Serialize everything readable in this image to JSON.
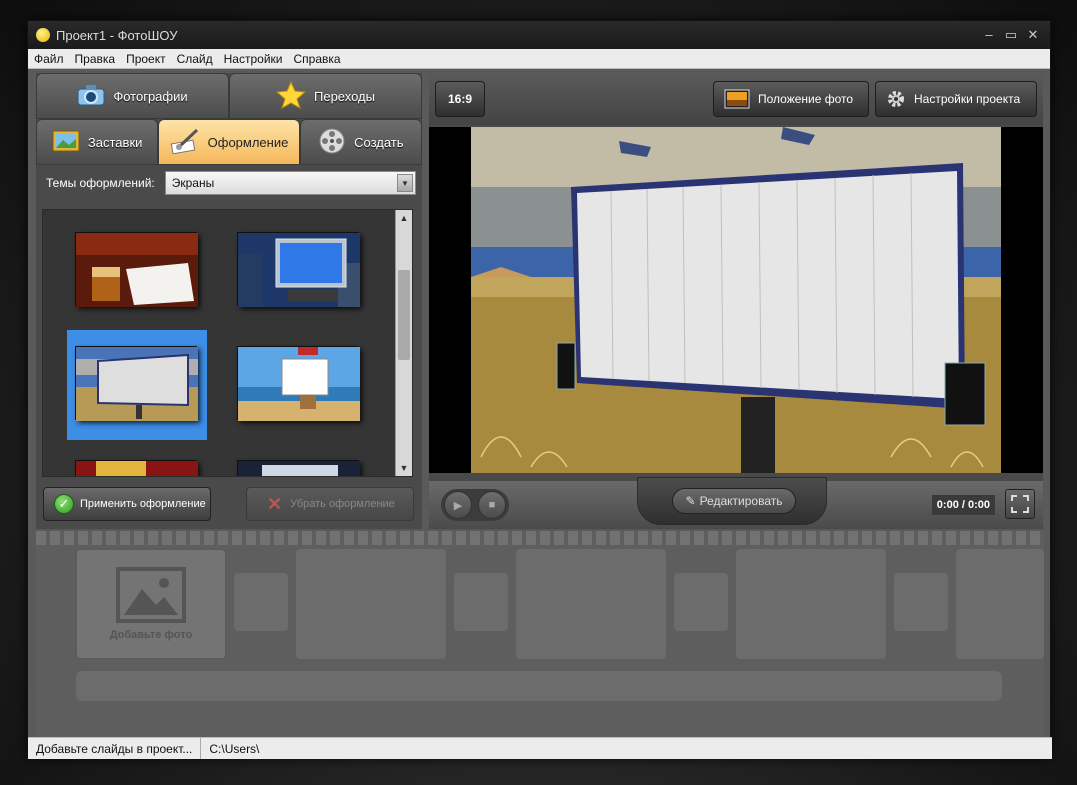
{
  "window": {
    "title": "Проект1 - ФотоШОУ",
    "controls": [
      "–",
      "▭",
      "✕"
    ]
  },
  "menu": [
    "Файл",
    "Правка",
    "Проект",
    "Слайд",
    "Настройки",
    "Справка"
  ],
  "tabs": {
    "row1": [
      {
        "label": "Фотографии",
        "icon": "camera-icon"
      },
      {
        "label": "Переходы",
        "icon": "star-icon"
      }
    ],
    "row2": [
      {
        "label": "Заставки",
        "icon": "picture-frame-icon"
      },
      {
        "label": "Оформление",
        "icon": "brush-icon",
        "active": true
      },
      {
        "label": "Создать",
        "icon": "film-reel-icon"
      }
    ]
  },
  "themes": {
    "label": "Темы оформлений:",
    "selected": "Экраны"
  },
  "gallery": {
    "thumbnails": [
      {
        "name": "whiskey-paper",
        "selected": false
      },
      {
        "name": "city-billboard",
        "selected": false
      },
      {
        "name": "desert-billboard",
        "selected": true
      },
      {
        "name": "beach-sign",
        "selected": false
      }
    ]
  },
  "actions": {
    "apply": "Применить оформление",
    "remove": "Убрать оформление"
  },
  "toolbar": {
    "ratio": "16:9",
    "photo_position": "Положение фото",
    "project_settings": "Настройки проекта"
  },
  "player": {
    "edit": "Редактировать",
    "time": "0:00 / 0:00"
  },
  "timeline": {
    "add_photo": "Добавьте фото"
  },
  "status": {
    "hint": "Добавьте слайды в проект...",
    "path": "C:\\Users\\"
  },
  "colors": {
    "accent_tab": "#f5b85a",
    "selection": "#3d8ee6",
    "panel": "#4a4a4a"
  }
}
